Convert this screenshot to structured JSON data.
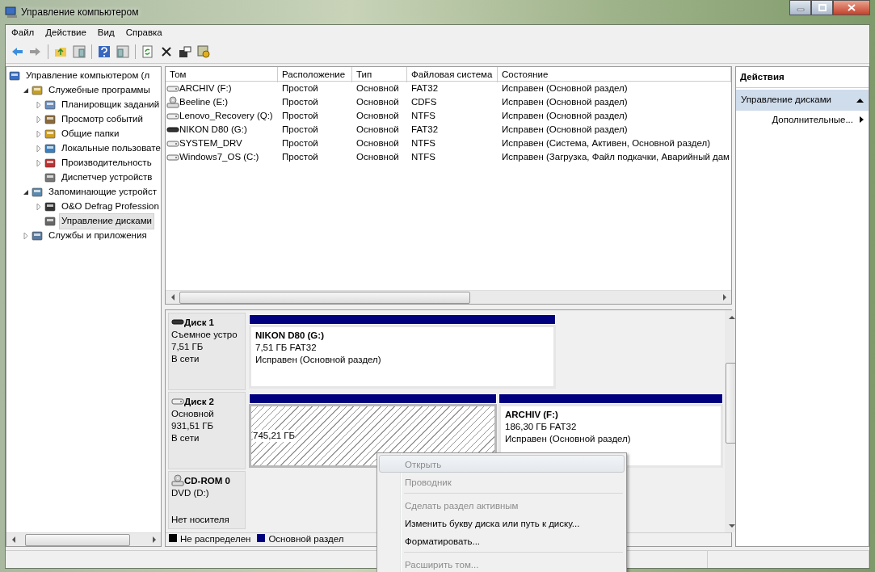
{
  "window": {
    "title": "Управление компьютером"
  },
  "menu": [
    "Файл",
    "Действие",
    "Вид",
    "Справка"
  ],
  "tree": [
    {
      "label": "Управление компьютером (л",
      "selected": false,
      "children": [
        {
          "label": "Служебные программы",
          "expanded": true,
          "selected": false,
          "children": [
            {
              "label": "Планировщик заданий",
              "expanded": false,
              "selected": false
            },
            {
              "label": "Просмотр событий",
              "expanded": false,
              "selected": false
            },
            {
              "label": "Общие папки",
              "expanded": false,
              "selected": false
            },
            {
              "label": "Локальные пользовате",
              "expanded": false,
              "selected": false
            },
            {
              "label": "Производительность",
              "expanded": false,
              "selected": false
            },
            {
              "label": "Диспетчер устройств",
              "selected": false
            }
          ]
        },
        {
          "label": "Запоминающие устройст",
          "expanded": true,
          "selected": false,
          "children": [
            {
              "label": "O&O Defrag Profession",
              "expanded": false,
              "selected": false
            },
            {
              "label": "Управление дисками",
              "selected": true
            }
          ]
        },
        {
          "label": "Службы и приложения",
          "expanded": false,
          "selected": false
        }
      ]
    }
  ],
  "volumes": {
    "columns": [
      "Том",
      "Расположение",
      "Тип",
      "Файловая система",
      "Состояние"
    ],
    "rows": [
      {
        "kind": "disk",
        "cells": [
          "ARCHIV (F:)",
          "Простой",
          "Основной",
          "FAT32",
          "Исправен (Основной раздел)"
        ]
      },
      {
        "kind": "cd",
        "cells": [
          "Beeline (E:)",
          "Простой",
          "Основной",
          "CDFS",
          "Исправен (Основной раздел)"
        ]
      },
      {
        "kind": "disk",
        "cells": [
          "Lenovo_Recovery (Q:)",
          "Простой",
          "Основной",
          "NTFS",
          "Исправен (Основной раздел)"
        ]
      },
      {
        "kind": "removable",
        "cells": [
          "NIKON D80 (G:)",
          "Простой",
          "Основной",
          "FAT32",
          "Исправен (Основной раздел)"
        ]
      },
      {
        "kind": "disk",
        "cells": [
          "SYSTEM_DRV",
          "Простой",
          "Основной",
          "NTFS",
          "Исправен (Система, Активен, Основной раздел)"
        ]
      },
      {
        "kind": "disk",
        "cells": [
          "Windows7_OS (C:)",
          "Простой",
          "Основной",
          "NTFS",
          "Исправен (Загрузка, Файл подкачки, Аварийный дам"
        ]
      }
    ]
  },
  "disks": [
    {
      "kind": "removable",
      "name": "Диск 1",
      "lines": [
        "Съемное устро",
        "7,51 ГБ",
        "В сети"
      ],
      "partitions": [
        {
          "kind": "primary",
          "selected": false,
          "title": "NIKON D80  (G:)",
          "lines": [
            "7,51 ГБ FAT32",
            "Исправен (Основной раздел)"
          ]
        }
      ]
    },
    {
      "kind": "disk",
      "name": "Диск 2",
      "lines": [
        "Основной",
        "931,51 ГБ",
        "В сети"
      ],
      "partitions": [
        {
          "kind": "unallocated",
          "selected": true,
          "lines": [
            "745,21 ГБ"
          ]
        },
        {
          "kind": "primary",
          "selected": false,
          "title": "ARCHIV  (F:)",
          "lines": [
            "186,30 ГБ FAT32",
            "Исправен (Основной раздел)"
          ]
        }
      ]
    },
    {
      "kind": "cd",
      "name": "CD-ROM 0",
      "lines": [
        "DVD (D:)"
      ],
      "media": "Нет носителя"
    }
  ],
  "legend": [
    {
      "label": "Не распределен",
      "color": "#000000"
    },
    {
      "label": "Основной раздел",
      "color": "#00007f"
    }
  ],
  "actions": {
    "header": "Действия",
    "section": "Управление дисками",
    "items": [
      "Дополнительные..."
    ]
  },
  "context_menu": [
    {
      "kind": "item",
      "label": "Открыть",
      "disabled": true,
      "selected": true
    },
    {
      "kind": "item",
      "label": "Проводник",
      "disabled": true,
      "selected": false
    },
    {
      "kind": "separator"
    },
    {
      "kind": "item",
      "label": "Сделать раздел активным",
      "disabled": true,
      "selected": false
    },
    {
      "kind": "item",
      "label": "Изменить букву диска или путь к диску...",
      "disabled": false,
      "selected": false
    },
    {
      "kind": "item",
      "label": "Форматировать...",
      "disabled": false,
      "selected": false
    },
    {
      "kind": "separator"
    },
    {
      "kind": "item",
      "label": "Расширить том...",
      "disabled": true,
      "selected": false
    }
  ]
}
